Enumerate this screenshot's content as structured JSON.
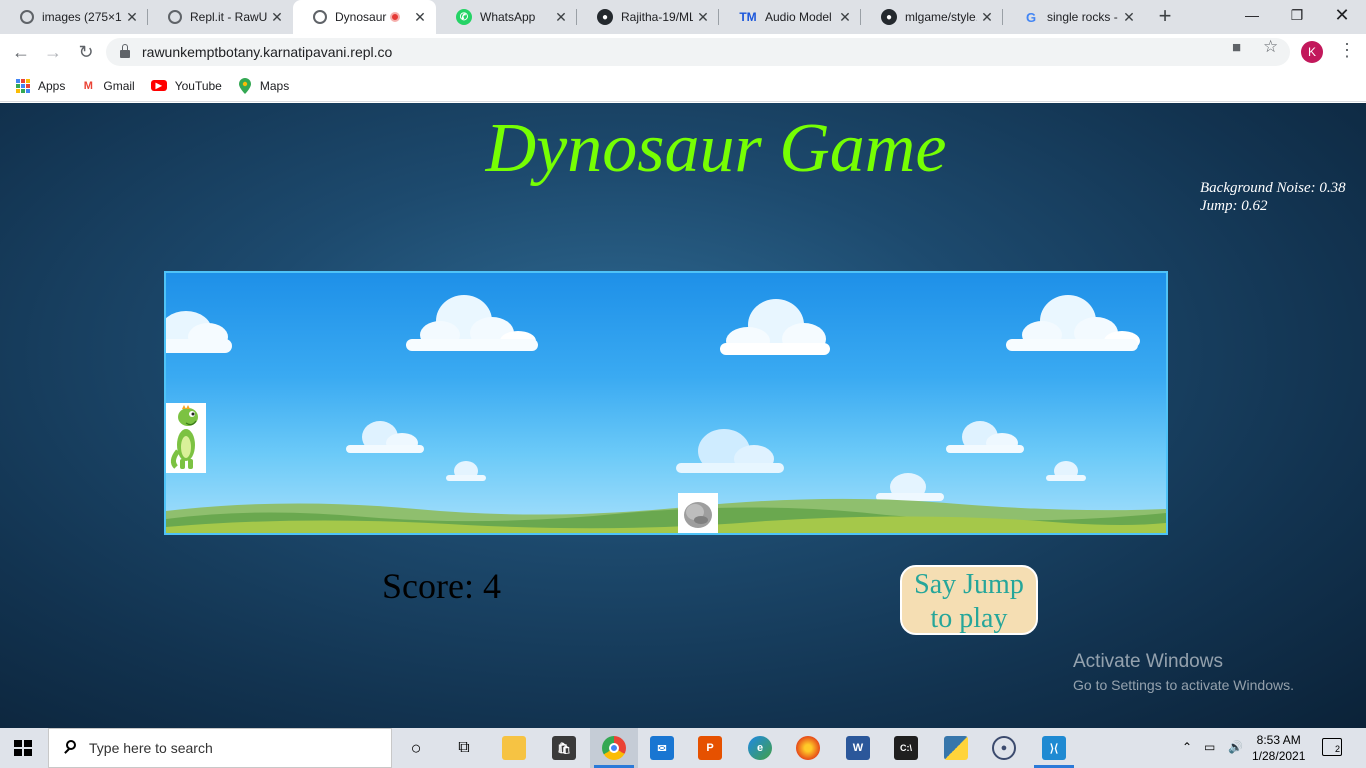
{
  "browser": {
    "tabs": [
      {
        "title": "images (275×1",
        "favicon": "globe-icon",
        "active": false
      },
      {
        "title": "Repl.it - RawU",
        "favicon": "replit-icon",
        "active": false
      },
      {
        "title": "Dynosaur",
        "favicon": "globe-icon",
        "active": true
      },
      {
        "title": "WhatsApp",
        "favicon": "whatsapp-icon",
        "active": false
      },
      {
        "title": "Rajitha-19/ML",
        "favicon": "github-icon",
        "active": false
      },
      {
        "title": "Audio Model -",
        "favicon": "tm-icon",
        "active": false
      },
      {
        "title": "mlgame/style.",
        "favicon": "github-icon",
        "active": false
      },
      {
        "title": "single rocks - ",
        "favicon": "google-icon",
        "active": false
      }
    ],
    "url": "rawunkemptbotany.karnatipavani.repl.co",
    "profile_initial": "K",
    "bookmarks": [
      {
        "label": "Apps",
        "icon": "apps-grid-icon"
      },
      {
        "label": "Gmail",
        "icon": "gmail-icon"
      },
      {
        "label": "YouTube",
        "icon": "youtube-icon"
      },
      {
        "label": "Maps",
        "icon": "maps-pin-icon"
      }
    ]
  },
  "game": {
    "title": "Dynosaur Game",
    "background_noise_label": "Background Noise: 0.38",
    "jump_label": "Jump: 0.62",
    "score_label": "Score: 4",
    "button_label_line1": "Say Jump",
    "button_label_line2": "to play",
    "title_color": "#76ff03",
    "button_text_color": "#26a69a",
    "button_bg_color": "#f5deb3"
  },
  "watermark": {
    "line1": "Activate Windows",
    "line2": "Go to Settings to activate Windows."
  },
  "taskbar": {
    "search_placeholder": "Type here to search",
    "time": "8:53 AM",
    "date": "1/28/2021",
    "notification_count": "2"
  }
}
